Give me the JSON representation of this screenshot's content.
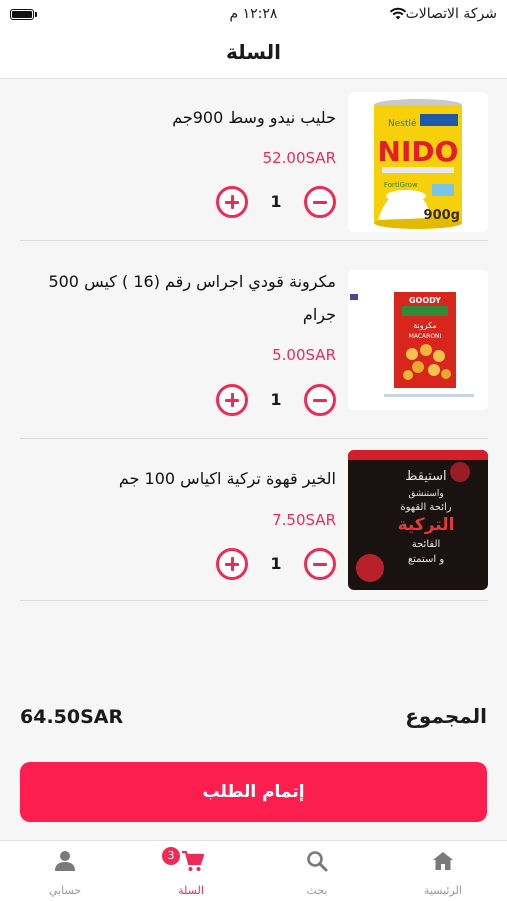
{
  "status_bar": {
    "carrier": "شركة الاتصالات",
    "time": "١٢:٢٨ م"
  },
  "header": {
    "title": "السلة"
  },
  "cart": {
    "items": [
      {
        "name": "حليب نيدو وسط 900جم",
        "price": "52.00SAR",
        "quantity": "1"
      },
      {
        "name": "مكرونة قودي اجراس رقم (16 ) كيس 500 جرام",
        "price": "5.00SAR",
        "quantity": "1"
      },
      {
        "name": "الخير قهوة تركية اكياس 100 جم",
        "price": "7.50SAR",
        "quantity": "1"
      }
    ]
  },
  "product_images": {
    "nido": {
      "brand": "Nestlé",
      "logo": "NIDO",
      "weight": "900g",
      "tag": "FortiGrow"
    },
    "pasta": {
      "brand": "GOODY",
      "arabic": "مكرونة",
      "label": "MACARONI"
    },
    "coffee": {
      "line1": "استيقظ",
      "line2": "واستنشق",
      "line3": "رائحة القهوة",
      "line4": "التركية",
      "line5": "الفائحة",
      "line6": "و استمتع"
    }
  },
  "summary": {
    "total_label": "المجموع",
    "total_value": "64.50SAR",
    "checkout_label": "إتمام الطلب"
  },
  "tabs": [
    {
      "label": "الرئيسية",
      "icon": "home-icon"
    },
    {
      "label": "بحث",
      "icon": "search-icon"
    },
    {
      "label": "السلة",
      "icon": "cart-icon",
      "badge": "3",
      "active": true
    },
    {
      "label": "حسابي",
      "icon": "user-icon"
    }
  ],
  "colors": {
    "accent": "#ee2a57",
    "checkout_button": "#fc1e4f",
    "background": "#f6f6f6"
  }
}
